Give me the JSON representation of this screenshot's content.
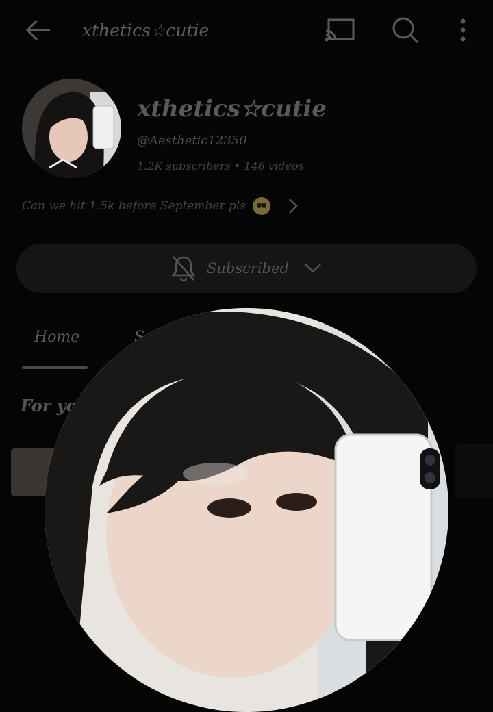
{
  "topbar": {
    "back_icon": "arrow-left-icon",
    "title": "xthetics☆cutie",
    "cast_icon": "cast-icon",
    "search_icon": "search-icon",
    "more_icon": "more-vertical-icon"
  },
  "channel": {
    "name": "xthetics☆cutie",
    "handle": "@Aesthetic12350",
    "meta": "1.2K subscribers • 146 videos",
    "description": "Can we hit 1.5k before September pls",
    "description_emoji": "pleading-face-emoji"
  },
  "subscribe": {
    "label": "Subscribed",
    "bell_icon": "bell-off-icon",
    "chevron_icon": "chevron-down-icon"
  },
  "tabs": [
    {
      "label": "Home",
      "active": true
    },
    {
      "label": "S",
      "active": false
    }
  ],
  "section": {
    "title": "For you"
  },
  "colors": {
    "background": "#050505",
    "text": "#4a4a4a",
    "button": "#151515"
  }
}
